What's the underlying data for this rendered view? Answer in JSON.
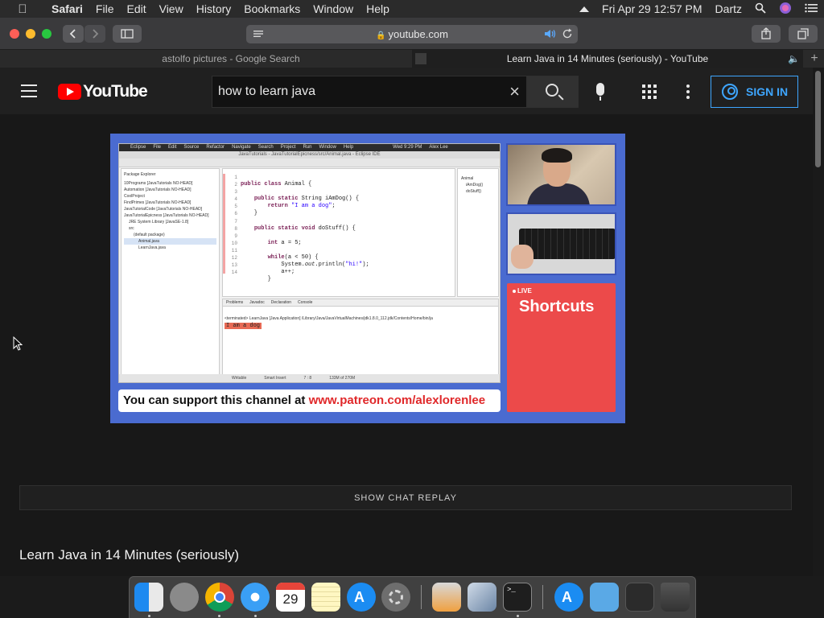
{
  "menubar": {
    "apple": "",
    "items": [
      "Safari",
      "File",
      "Edit",
      "View",
      "History",
      "Bookmarks",
      "Window",
      "Help"
    ],
    "datetime": "Fri Apr 29  12:57 PM",
    "user": "Dartz"
  },
  "safari": {
    "url": "youtube.com",
    "tabs": [
      {
        "title": "astolfo pictures - Google Search",
        "active": false
      },
      {
        "title": "Learn Java in 14 Minutes (seriously) - YouTube",
        "active": true
      }
    ]
  },
  "youtube": {
    "logo_text": "YouTube",
    "search_query": "how to learn java",
    "signin_label": "SIGN IN",
    "show_chat_replay": "SHOW CHAT REPLAY",
    "video_title": "Learn Java in 14 Minutes (seriously)",
    "accent": "#3ea6ff",
    "brand_red": "#ff0000"
  },
  "video_frame": {
    "ide_menu": [
      "Eclipse",
      "File",
      "Edit",
      "Source",
      "Refactor",
      "Navigate",
      "Search",
      "Project",
      "Run",
      "Window",
      "Help",
      "Wed 9:29 PM",
      "Alex Lee"
    ],
    "ide_title": "JavaTutorials - JavaTutorialEpicness/src/Animal.java - Eclipse IDE",
    "package_explorer": [
      "Package Explorer",
      "10Programs [JavaTutorials NO-HEAD]",
      "Automation [JavaTutorials NO-HEAD]",
      "CoolProject",
      "FindPrimes [JavaTutorials NO-HEAD]",
      "JavaTutorialCode [JavaTutorials NO-HEAD]",
      "JavaTutorialEpicness [JavaTutorials NO-HEAD]",
      "JRE System Library [JavaSE-1.8]",
      "src",
      "(default package)",
      "Animal.java",
      "LearnJava.java"
    ],
    "line_numbers": [
      "1",
      "2",
      "3",
      "4",
      "5",
      "6",
      "7",
      "8",
      "9",
      "10",
      "11",
      "12",
      "13",
      "14"
    ],
    "outline": [
      "Animal",
      "iAmDog()",
      "doStuff()"
    ],
    "console_tabs": [
      "Problems",
      "Javadoc",
      "Declaration",
      "Console"
    ],
    "console_terminated": "<terminated> LearnJava [Java Application] /Library/Java/JavaVirtualMachines/jdk1.8.0_112.jdk/Contents/Home/bin/ja",
    "console_output": "I am a dog",
    "status": [
      "Writable",
      "Smart Insert",
      "7 : 8",
      "133M of 270M"
    ],
    "live_tag": "LIVE",
    "live_title": "Shortcuts",
    "support_text": "You can support this channel at ",
    "support_link": "www.patreon.com/alexlorenlee"
  }
}
